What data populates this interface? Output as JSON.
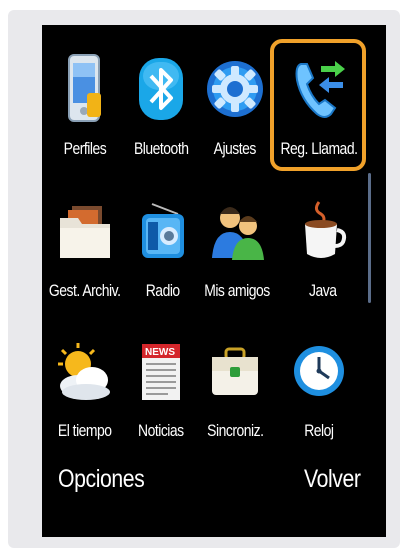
{
  "apps": [
    {
      "label": "Perfiles",
      "icon": "phone-profile-icon"
    },
    {
      "label": "Bluetooth",
      "icon": "bluetooth-icon"
    },
    {
      "label": "Ajustes",
      "icon": "gear-icon"
    },
    {
      "label": "Reg. Llamad.",
      "icon": "call-log-icon",
      "selected": true
    },
    {
      "label": "Gest. Archiv.",
      "icon": "folder-icon"
    },
    {
      "label": "Radio",
      "icon": "radio-icon"
    },
    {
      "label": "Mis amigos",
      "icon": "friends-icon"
    },
    {
      "label": "Java",
      "icon": "java-cup-icon"
    },
    {
      "label": "El tiempo",
      "icon": "weather-icon"
    },
    {
      "label": "Noticias",
      "icon": "news-icon"
    },
    {
      "label": "Sincroniz.",
      "icon": "sync-briefcase-icon"
    },
    {
      "label": "Reloj",
      "icon": "clock-icon"
    }
  ],
  "softkeys": {
    "left": "Opciones",
    "right": "Volver"
  },
  "colors": {
    "highlight": "#f0a12a",
    "background": "#000000",
    "text": "#ffffff"
  }
}
